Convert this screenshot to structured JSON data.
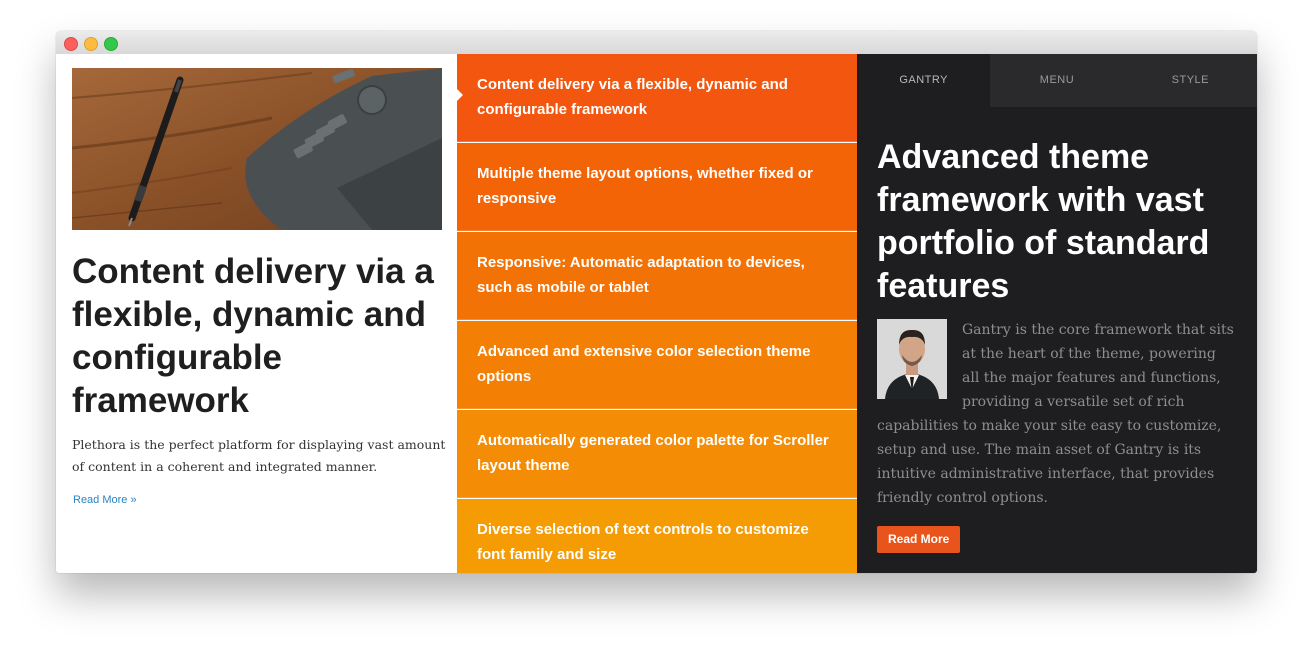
{
  "window": {
    "controls": [
      "close",
      "minimize",
      "zoom"
    ]
  },
  "left": {
    "image_icon": "drawing-tablet-and-pen-photo",
    "title": "Content delivery via a flexible, dynamic and configurable framework",
    "description": "Plethora is the perfect platform for displaying vast amount of content in a coherent and integrated manner.",
    "link": "Read More »"
  },
  "middle": {
    "features": [
      {
        "label": "Content delivery via a flexible, dynamic and configurable framework",
        "color": "#f2560f"
      },
      {
        "label": "Multiple theme layout options, whether fixed or responsive",
        "color": "#f36407"
      },
      {
        "label": "Responsive: Automatic adaptation to devices, such as mobile or tablet",
        "color": "#f37206"
      },
      {
        "label": "Advanced and extensive color selection theme options",
        "color": "#f47f05"
      },
      {
        "label": "Automatically generated color palette for Scroller layout theme",
        "color": "#f48c05"
      },
      {
        "label": "Diverse selection of text controls to customize font family and size",
        "color": "#f59b04"
      }
    ]
  },
  "right": {
    "tabs": [
      "GANTRY",
      "MENU",
      "STYLE"
    ],
    "title": "Advanced theme framework with vast portfolio of standard features",
    "avatar_icon": "man-in-suit-portrait",
    "body": "Gantry is the core framework that sits at the heart of the theme, powering all the major features and functions, providing a versatile set of rich capabilities to make your site easy to customize, setup and use. The main asset of Gantry is its intuitive administrative interface, that provides friendly control options.",
    "button": "Read More"
  },
  "colors": {
    "accent": "#e8541b",
    "dark_panel": "#1e1e20",
    "link": "#2a84c5"
  }
}
